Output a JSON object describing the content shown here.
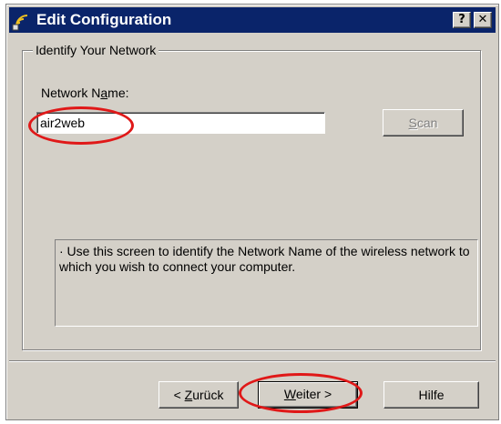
{
  "window": {
    "title": "Edit Configuration",
    "help_button": "?",
    "close_button": "✕"
  },
  "group": {
    "label": "Identify Your Network",
    "network_name_label_pre": "Network N",
    "network_name_label_underline": "a",
    "network_name_label_post": "me:",
    "network_name_value": "air2web",
    "scan_button_underline": "S",
    "scan_button_rest": "can",
    "info_text": "· Use this screen to identify the Network Name of the wireless network to which you wish to connect your computer."
  },
  "buttons": {
    "back_prefix": "< ",
    "back_underline": "Z",
    "back_rest": "urück",
    "next_underline": "W",
    "next_rest": "eiter >",
    "help": "Hilfe"
  },
  "colors": {
    "titlebar": "#0a246a",
    "dialog": "#d4d0c8",
    "annotation": "#e01818"
  }
}
